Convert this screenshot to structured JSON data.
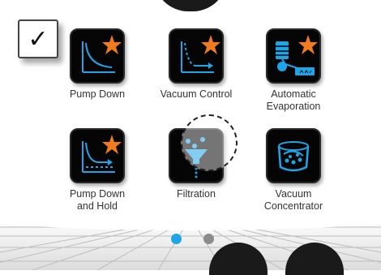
{
  "checkbox": {
    "mark": "✓",
    "checked": true
  },
  "colors": {
    "accent": "#1ea5e8",
    "star": "#f07a1e",
    "tile": "#050505"
  },
  "tiles": [
    {
      "label": "Pump Down",
      "icon": "pump-down-curve-icon",
      "starred": true
    },
    {
      "label": "Vacuum Control",
      "icon": "vacuum-control-curve-icon",
      "starred": true
    },
    {
      "label": "Automatic Evaporation",
      "icon": "automatic-evaporation-icon",
      "starred": true
    },
    {
      "label": "Pump Down and Hold",
      "icon": "pump-down-hold-curve-icon",
      "starred": true
    },
    {
      "label": "Filtration",
      "icon": "filtration-funnel-icon",
      "starred": false
    },
    {
      "label": "Vacuum Concentrator",
      "icon": "vacuum-concentrator-icon",
      "starred": false
    }
  ],
  "pagination": {
    "pages": 2,
    "current": 1
  }
}
